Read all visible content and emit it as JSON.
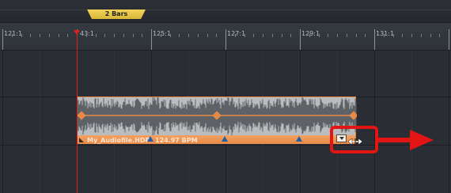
{
  "loop_region": {
    "label": "2 Bars"
  },
  "ruler": {
    "labels": [
      "121:1",
      "43:1",
      "125:1",
      "127:1",
      "129:1",
      "131:1"
    ]
  },
  "clip": {
    "name": "My_Audiofile.HDP",
    "tempo": "124.97 BPM",
    "color": "#e88a45",
    "waveform_color": "#5e6266"
  },
  "colors": {
    "playhead": "#e0201e",
    "highlight": "#e21515",
    "loop_region": "#f2d35a",
    "bar_marker": "#1f5fa8"
  },
  "icons": {
    "stretch_handle": "dropdown-triangle-icon",
    "cursor": "horizontal-resize-cursor-icon",
    "annotation": "right-arrow-icon"
  }
}
